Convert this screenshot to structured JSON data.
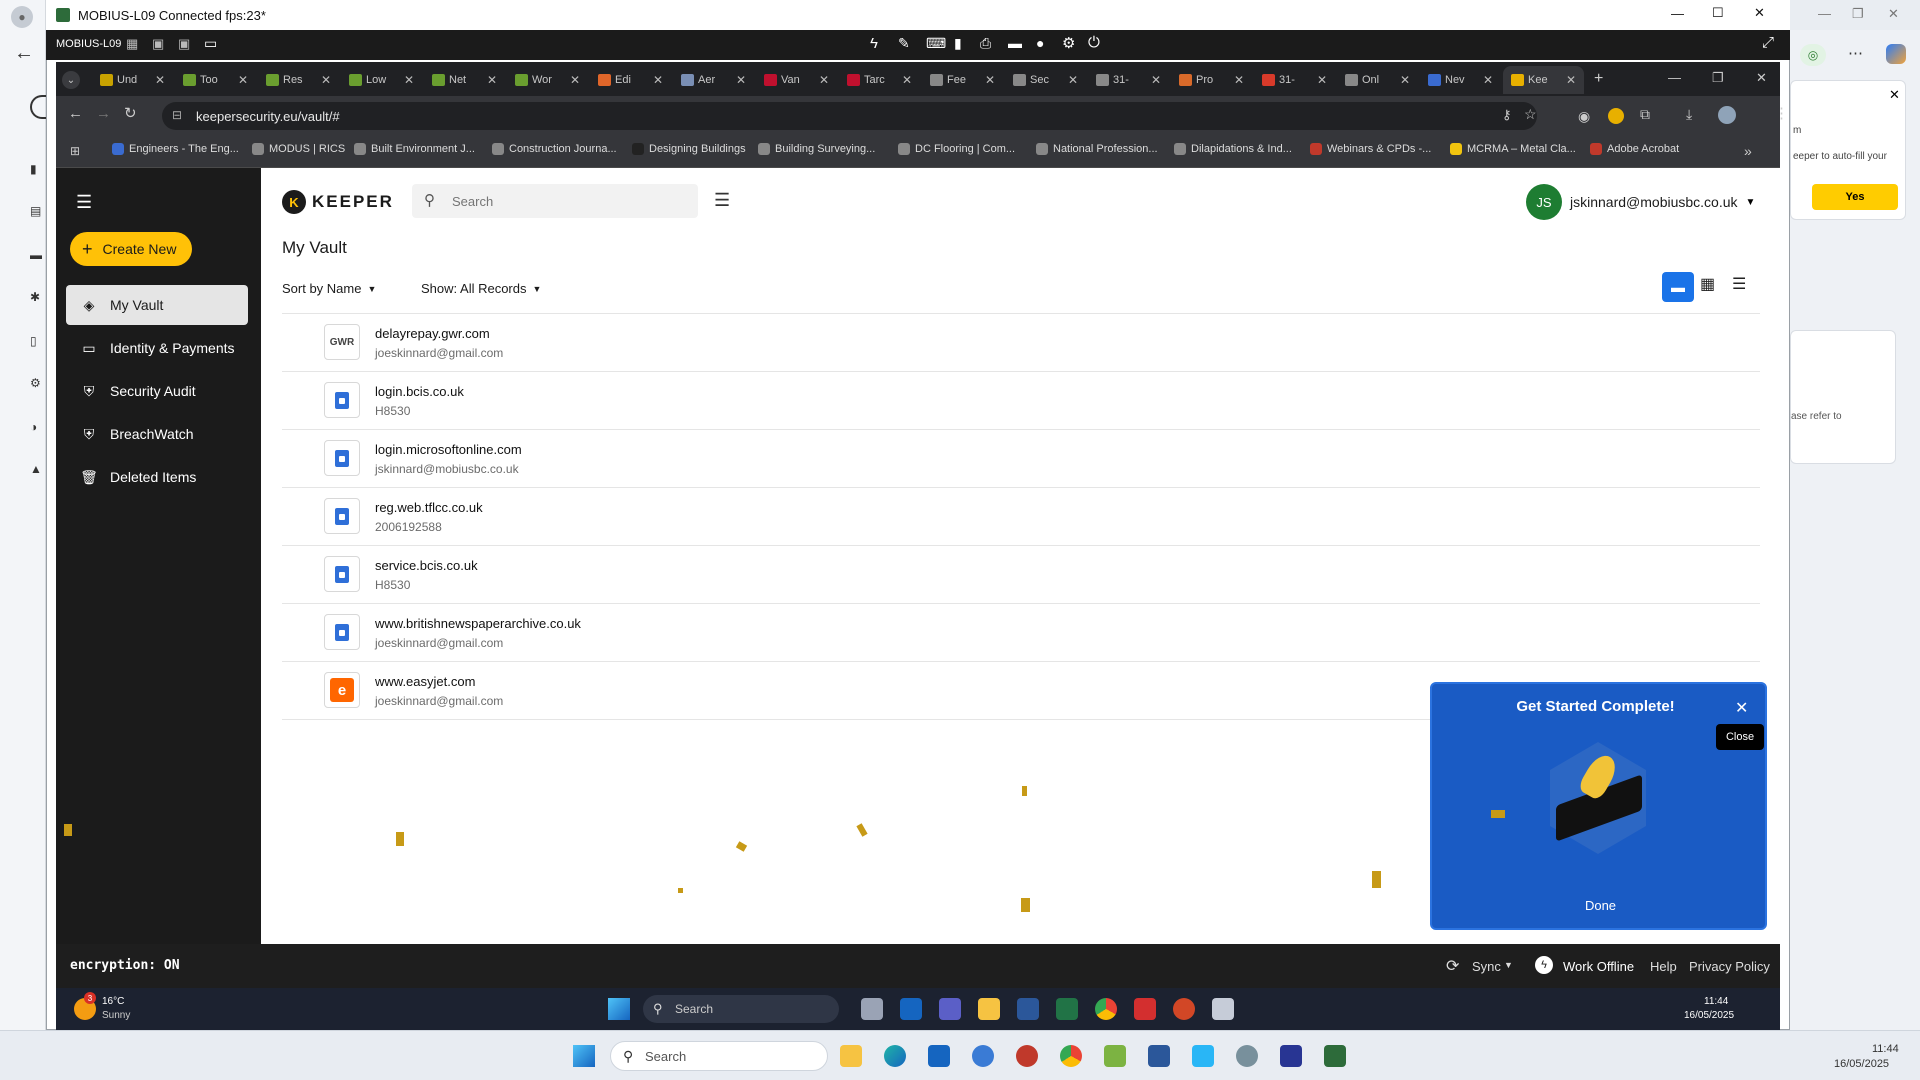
{
  "window": {
    "title": "MOBIUS-L09 Connected fps:23*",
    "toolbar_label": "MOBIUS-L09"
  },
  "tabs": [
    {
      "label": "Und",
      "color": "#c8a200"
    },
    {
      "label": "Too",
      "color": "#6a9e2f"
    },
    {
      "label": "Res",
      "color": "#6a9e2f"
    },
    {
      "label": "Low",
      "color": "#6a9e2f"
    },
    {
      "label": "Net",
      "color": "#6a9e2f"
    },
    {
      "label": "Wor",
      "color": "#6a9e2f"
    },
    {
      "label": "Edi",
      "color": "#e0662a"
    },
    {
      "label": "Aer",
      "color": "#7a8fb5"
    },
    {
      "label": "Van",
      "color": "#c0102e"
    },
    {
      "label": "Tarc",
      "color": "#c0102e"
    },
    {
      "label": "Fee",
      "color": "#888888"
    },
    {
      "label": "Sec",
      "color": "#888888"
    },
    {
      "label": "31-",
      "color": "#888888"
    },
    {
      "label": "Pro",
      "color": "#d96a2a"
    },
    {
      "label": "31-",
      "color": "#d83a2a"
    },
    {
      "label": "Onl",
      "color": "#888888"
    },
    {
      "label": "Nev",
      "color": "#3a6bd0"
    },
    {
      "label": "Kee",
      "color": "#e8b000"
    }
  ],
  "browser": {
    "url": "keepersecurity.eu/vault/#"
  },
  "bookmarks": [
    "Engineers - The Eng...",
    "MODUS | RICS",
    "Built Environment J...",
    "Construction Journa...",
    "Designing Buildings",
    "Building Surveying...",
    "DC Flooring | Com...",
    "National Profession...",
    "Dilapidations & Ind...",
    "Webinars & CPDs -...",
    "MCRMA – Metal Cla...",
    "Adobe Acrobat"
  ],
  "keeper": {
    "logo": "KEEPER",
    "search_placeholder": "Search",
    "user_initials": "JS",
    "user_email": "jskinnard@mobiusbc.co.uk",
    "create_label": "Create New",
    "page_title": "My Vault",
    "sort_label": "Sort by Name",
    "show_label": "Show: All Records"
  },
  "nav": [
    {
      "label": "My Vault",
      "icon": "vault-icon"
    },
    {
      "label": "Identity & Payments",
      "icon": "card-icon"
    },
    {
      "label": "Security Audit",
      "icon": "shield-icon"
    },
    {
      "label": "BreachWatch",
      "icon": "breachwatch-icon"
    },
    {
      "label": "Deleted Items",
      "icon": "trash-icon"
    }
  ],
  "records": [
    {
      "title": "delayrepay.gwr.com",
      "sub": "joeskinnard@gmail.com",
      "icon": "gwr"
    },
    {
      "title": "login.bcis.co.uk",
      "sub": "H8530",
      "icon": "doc"
    },
    {
      "title": "login.microsoftonline.com",
      "sub": "jskinnard@mobiusbc.co.uk",
      "icon": "doc"
    },
    {
      "title": "reg.web.tflcc.co.uk",
      "sub": "2006192588",
      "icon": "doc"
    },
    {
      "title": "service.bcis.co.uk",
      "sub": "H8530",
      "icon": "doc"
    },
    {
      "title": "www.britishnewspaperarchive.co.uk",
      "sub": "joeskinnard@gmail.com",
      "icon": "doc"
    },
    {
      "title": "www.easyjet.com",
      "sub": "joeskinnard@gmail.com",
      "icon": "easyjet"
    }
  ],
  "card": {
    "title": "Get Started Complete!",
    "done": "Done",
    "tooltip": "Close"
  },
  "footer": {
    "encryption": "encryption: ON",
    "sync": "Sync",
    "offline": "Work Offline",
    "help": "Help",
    "privacy": "Privacy Policy"
  },
  "inner_taskbar": {
    "temp": "16°C",
    "weather": "Sunny",
    "badge": "3",
    "search": "Search",
    "time": "11:44",
    "date": "16/05/2025"
  },
  "outer_taskbar": {
    "search": "Search",
    "time": "11:44",
    "date": "16/05/2025"
  },
  "side_popup": {
    "text1": "m",
    "text2": "eeper to auto-fill your",
    "yes": "Yes",
    "text3": "ase refer to"
  }
}
